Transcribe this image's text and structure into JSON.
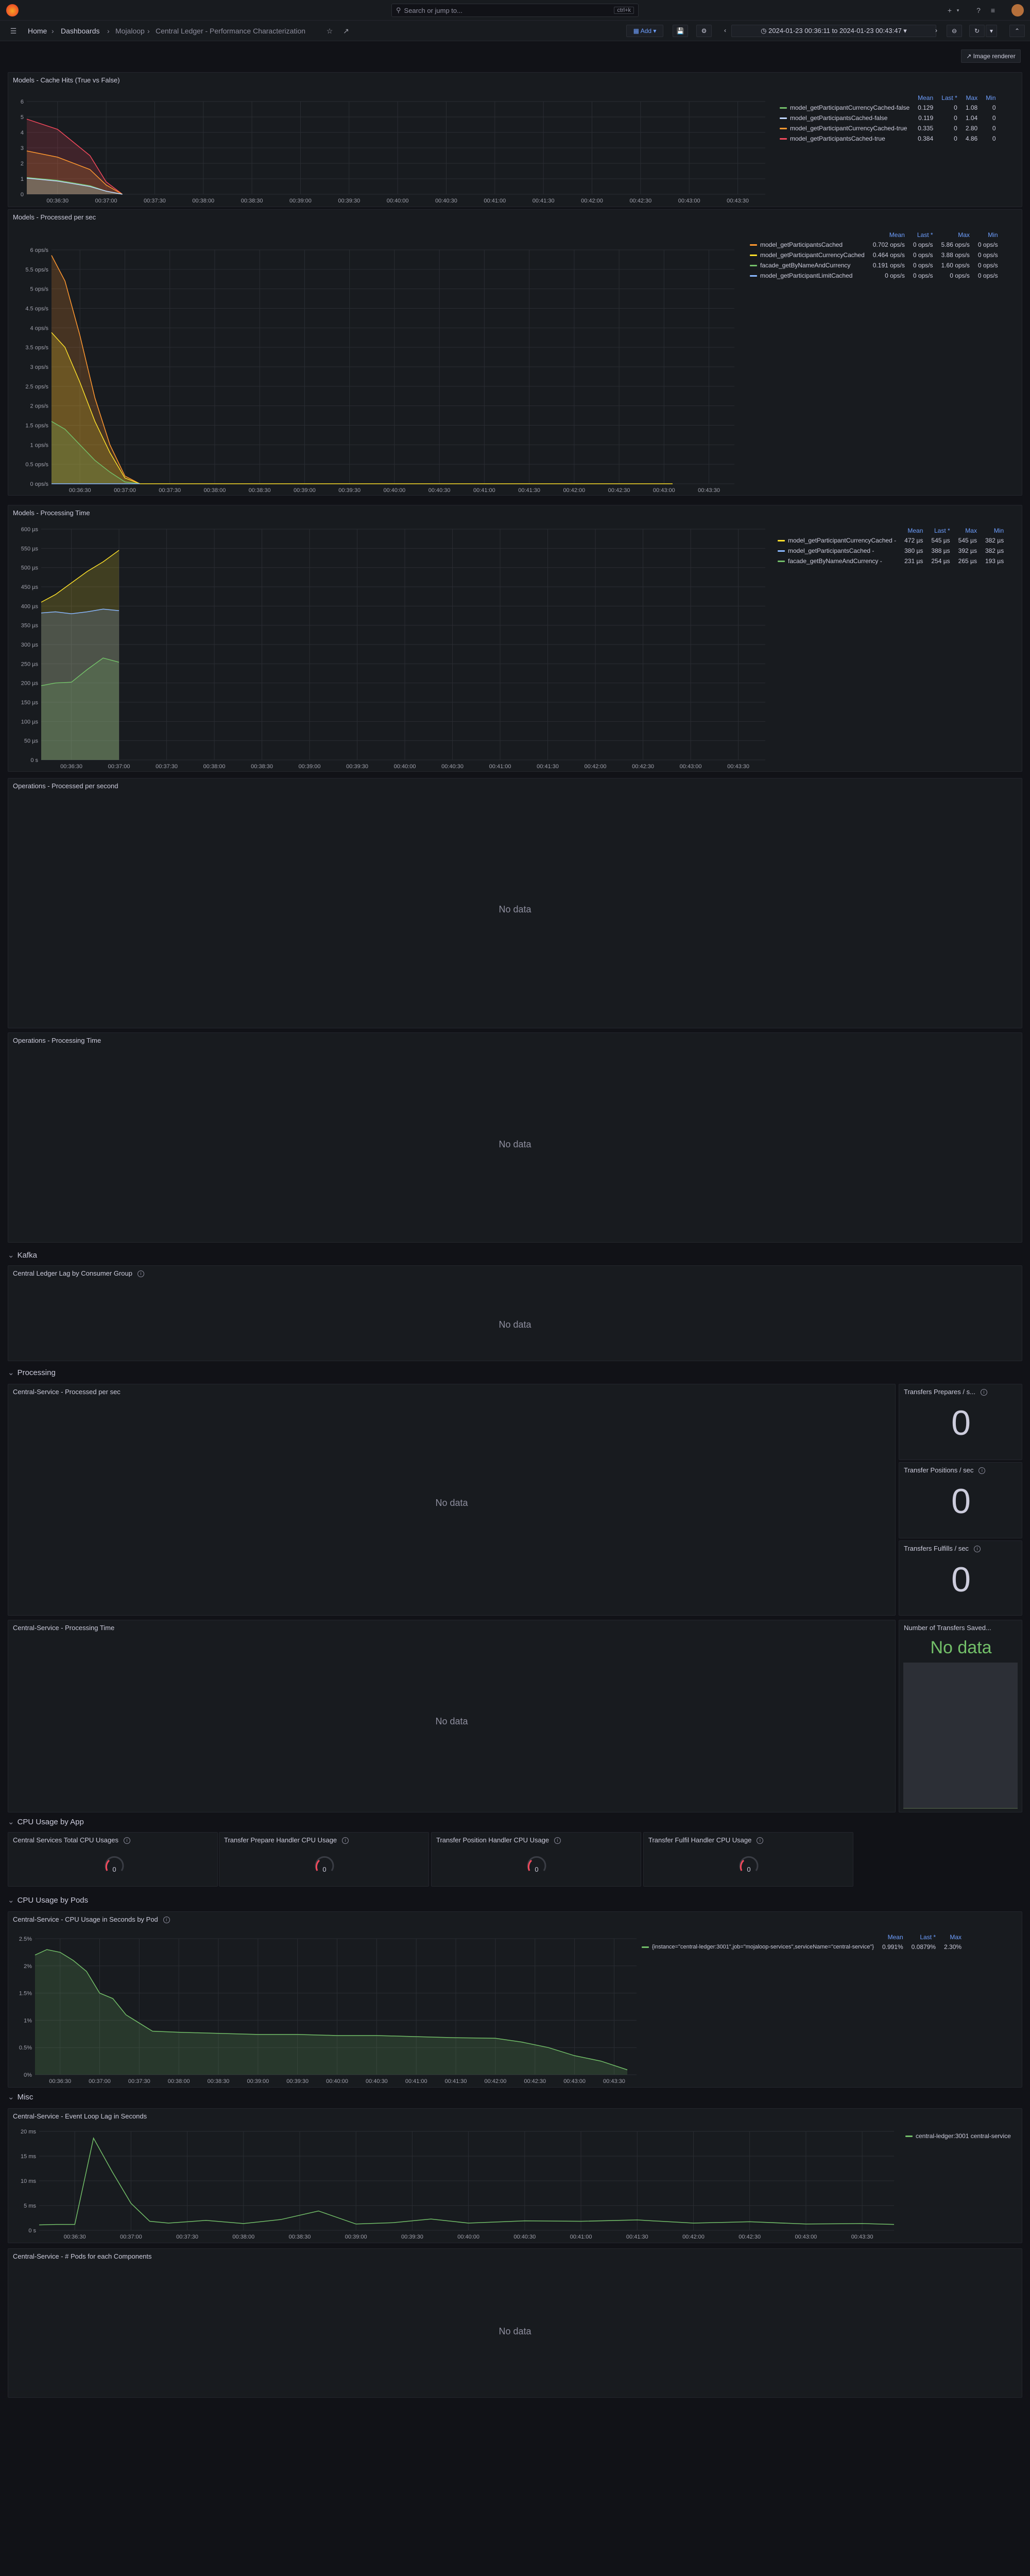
{
  "topbar": {
    "search_placeholder": "Search or jump to...",
    "search_shortcut": "ctrl+k"
  },
  "nav": {
    "home": "Home",
    "dashboards": "Dashboards",
    "folder": "Mojaloop",
    "dashboard": "Central Ledger - Performance Characterization",
    "add": "Add",
    "time_range": "2024-01-23 00:36:11 to 2024-01-23 00:43:47"
  },
  "image_renderer": "Image renderer",
  "tick_times_a": [
    "00:36:30",
    "00:37:00",
    "00:37:30",
    "00:38:00",
    "00:38:30",
    "00:39:00",
    "00:39:30",
    "00:40:00",
    "00:40:30",
    "00:41:00",
    "00:41:30",
    "00:42:00",
    "00:42:30",
    "00:43:00",
    "00:43:30"
  ],
  "panels": {
    "cache_hits": {
      "title": "Models - Cache Hits (True vs False)",
      "headers": [
        "Mean",
        "Last *",
        "Max",
        "Min"
      ],
      "rows": [
        {
          "name": "model_getParticipantCurrencyCached-false",
          "mean": "0.129",
          "last": "0",
          "max": "1.08",
          "min": "0",
          "color": "#73bf69"
        },
        {
          "name": "model_getParticipantsCached-false",
          "mean": "0.119",
          "last": "0",
          "max": "1.04",
          "min": "0",
          "color": "#c0d8ff"
        },
        {
          "name": "model_getParticipantCurrencyCached-true",
          "mean": "0.335",
          "last": "0",
          "max": "2.80",
          "min": "0",
          "color": "#ff9830"
        },
        {
          "name": "model_getParticipantsCached-true",
          "mean": "0.384",
          "last": "0",
          "max": "4.86",
          "min": "0",
          "color": "#f2495c"
        }
      ]
    },
    "processed": {
      "title": "Models - Processed per sec",
      "headers": [
        "Mean",
        "Last *",
        "Max",
        "Min"
      ],
      "rows": [
        {
          "name": "model_getParticipantsCached",
          "mean": "0.702 ops/s",
          "last": "0 ops/s",
          "max": "5.86 ops/s",
          "min": "0 ops/s",
          "color": "#ff9830"
        },
        {
          "name": "model_getParticipantCurrencyCached",
          "mean": "0.464 ops/s",
          "last": "0 ops/s",
          "max": "3.88 ops/s",
          "min": "0 ops/s",
          "color": "#fade2a"
        },
        {
          "name": "facade_getByNameAndCurrency",
          "mean": "0.191 ops/s",
          "last": "0 ops/s",
          "max": "1.60 ops/s",
          "min": "0 ops/s",
          "color": "#73bf69"
        },
        {
          "name": "model_getParticipantLimitCached",
          "mean": "0 ops/s",
          "last": "0 ops/s",
          "max": "0 ops/s",
          "min": "0 ops/s",
          "color": "#8ab8ff"
        }
      ]
    },
    "proc_time": {
      "title": "Models - Processing Time",
      "headers": [
        "Mean",
        "Last *",
        "Max",
        "Min"
      ],
      "rows": [
        {
          "name": "model_getParticipantCurrencyCached -",
          "mean": "472 µs",
          "last": "545 µs",
          "max": "545 µs",
          "min": "382 µs",
          "color": "#fade2a"
        },
        {
          "name": "model_getParticipantsCached -",
          "mean": "380 µs",
          "last": "388 µs",
          "max": "392 µs",
          "min": "382 µs",
          "color": "#8ab8ff"
        },
        {
          "name": "facade_getByNameAndCurrency -",
          "mean": "231 µs",
          "last": "254 µs",
          "max": "265 µs",
          "min": "193 µs",
          "color": "#73bf69"
        }
      ]
    },
    "ops_processed": {
      "title": "Operations - Processed per second",
      "nodata": "No data"
    },
    "ops_time": {
      "title": "Operations - Processing Time",
      "nodata": "No data"
    },
    "kafka_lag": {
      "title": "Central Ledger Lag by Consumer Group",
      "nodata": "No data"
    },
    "cs_processed": {
      "title": "Central-Service - Processed per sec",
      "nodata": "No data"
    },
    "tp_prepares": {
      "title": "Transfers Prepares / s...",
      "value": "0"
    },
    "tp_positions": {
      "title": "Transfer Positions / sec",
      "value": "0"
    },
    "tp_fulfils": {
      "title": "Transfers Fulfills / sec",
      "value": "0"
    },
    "cs_proc_time": {
      "title": "Central-Service - Processing Time",
      "nodata": "No data"
    },
    "saved": {
      "title": "Number of Transfers Saved...",
      "nodata": "No data"
    },
    "cpu_total": {
      "title": "Central Services Total CPU Usages",
      "value": "0"
    },
    "cpu_prepare": {
      "title": "Transfer Prepare Handler CPU Usage",
      "value": "0"
    },
    "cpu_position": {
      "title": "Transfer Position Handler CPU Usage",
      "value": "0"
    },
    "cpu_fulfil": {
      "title": "Transfer Fulfil Handler CPU Usage",
      "value": "0"
    },
    "cpu_pods": {
      "title": "Central-Service - CPU Usage in Seconds by Pod",
      "headers": [
        "Mean",
        "Last *",
        "Max"
      ],
      "rows": [
        {
          "name": "{instance=\"central-ledger:3001\",job=\"mojaloop-services\",serviceName=\"central-service\"}",
          "mean": "0.991%",
          "last": "0.0879%",
          "max": "2.30%",
          "color": "#73bf69"
        }
      ]
    },
    "event_loop": {
      "title": "Central-Service - Event Loop Lag in Seconds",
      "legend": "central-ledger:3001 central-service"
    },
    "pods": {
      "title": "Central-Service - # Pods for each Components",
      "nodata": "No data"
    }
  },
  "rows": {
    "kafka": "Kafka",
    "processing": "Processing",
    "cpu_app": "CPU Usage by App",
    "cpu_pods": "CPU Usage by Pods",
    "misc": "Misc"
  },
  "chart_data": [
    {
      "type": "area",
      "title": "Models - Cache Hits (True vs False)",
      "x": [
        "00:36:11",
        "00:36:30",
        "00:36:50",
        "00:37:00",
        "00:37:10"
      ],
      "ylim": [
        0,
        6
      ],
      "yticks": [
        "0",
        "1",
        "2",
        "3",
        "4",
        "5",
        "6"
      ],
      "series": [
        {
          "name": "model_getParticipantsCached-true",
          "values": [
            4.86,
            4.2,
            2.5,
            0.8,
            0
          ]
        },
        {
          "name": "model_getParticipantCurrencyCached-true",
          "values": [
            2.8,
            2.4,
            1.6,
            0.6,
            0
          ]
        },
        {
          "name": "model_getParticipantCurrencyCached-false",
          "values": [
            1.08,
            0.9,
            0.55,
            0.2,
            0
          ]
        },
        {
          "name": "model_getParticipantsCached-false",
          "values": [
            1.04,
            0.85,
            0.5,
            0.2,
            0
          ]
        }
      ]
    },
    {
      "type": "area",
      "title": "Models - Processed per sec",
      "x": [
        "00:36:11",
        "00:36:20",
        "00:36:30",
        "00:36:40",
        "00:36:50",
        "00:37:00",
        "00:37:10"
      ],
      "ylim": [
        0,
        6
      ],
      "yticks": [
        "0 ops/s",
        "0.5 ops/s",
        "1 ops/s",
        "1.5 ops/s",
        "2 ops/s",
        "2.5 ops/s",
        "3 ops/s",
        "3.5 ops/s",
        "4 ops/s",
        "4.5 ops/s",
        "5 ops/s",
        "5.5 ops/s",
        "6 ops/s"
      ],
      "series": [
        {
          "name": "model_getParticipantsCached",
          "values": [
            5.86,
            5.2,
            3.8,
            2.2,
            1.0,
            0.2,
            0
          ]
        },
        {
          "name": "model_getParticipantCurrencyCached",
          "values": [
            3.88,
            3.5,
            2.6,
            1.6,
            0.8,
            0.15,
            0
          ]
        },
        {
          "name": "facade_getByNameAndCurrency",
          "values": [
            1.6,
            1.4,
            1.0,
            0.6,
            0.3,
            0.05,
            0
          ]
        },
        {
          "name": "model_getParticipantLimitCached",
          "values": [
            0,
            0,
            0,
            0,
            0,
            0,
            0
          ]
        }
      ]
    },
    {
      "type": "area",
      "title": "Models - Processing Time",
      "x": [
        "00:36:11",
        "00:36:20",
        "00:36:30",
        "00:36:40",
        "00:36:50",
        "00:37:00"
      ],
      "ylim": [
        0,
        600
      ],
      "yticks": [
        "0 s",
        "50 µs",
        "100 µs",
        "150 µs",
        "200 µs",
        "250 µs",
        "300 µs",
        "350 µs",
        "400 µs",
        "450 µs",
        "500 µs",
        "550 µs",
        "600 µs"
      ],
      "series": [
        {
          "name": "model_getParticipantCurrencyCached -",
          "values": [
            410,
            430,
            460,
            490,
            515,
            545
          ]
        },
        {
          "name": "model_getParticipantsCached -",
          "values": [
            382,
            385,
            380,
            385,
            392,
            388
          ]
        },
        {
          "name": "facade_getByNameAndCurrency -",
          "values": [
            193,
            200,
            202,
            235,
            265,
            254
          ]
        }
      ]
    },
    {
      "type": "area",
      "title": "Central-Service - CPU Usage in Seconds by Pod",
      "x": [
        "00:36:11",
        "00:36:20",
        "00:36:30",
        "00:36:40",
        "00:36:50",
        "00:37:00",
        "00:37:10",
        "00:37:20",
        "00:37:30",
        "00:37:40",
        "00:38:00",
        "00:38:30",
        "00:39:00",
        "00:39:30",
        "00:40:00",
        "00:40:30",
        "00:41:00",
        "00:41:30",
        "00:42:00",
        "00:42:20",
        "00:42:40",
        "00:43:00",
        "00:43:20",
        "00:43:40"
      ],
      "ylim": [
        0,
        2.5
      ],
      "yticks": [
        "0%",
        "0.5%",
        "1%",
        "1.5%",
        "2%",
        "2.5%"
      ],
      "series": [
        {
          "name": "{instance=\"central-ledger:3001\",job=\"mojaloop-services\",serviceName=\"central-service\"}",
          "values": [
            2.2,
            2.3,
            2.25,
            2.1,
            1.9,
            1.5,
            1.4,
            1.1,
            0.95,
            0.8,
            0.78,
            0.76,
            0.74,
            0.74,
            0.72,
            0.72,
            0.7,
            0.68,
            0.67,
            0.6,
            0.5,
            0.35,
            0.25,
            0.09
          ]
        }
      ]
    },
    {
      "type": "line",
      "title": "Central-Service - Event Loop Lag in Seconds",
      "x": [
        "00:36:11",
        "00:36:20",
        "00:36:30",
        "00:36:40",
        "00:36:50",
        "00:37:00",
        "00:37:10",
        "00:37:20",
        "00:37:40",
        "00:38:00",
        "00:38:20",
        "00:38:40",
        "00:39:00",
        "00:39:20",
        "00:39:40",
        "00:40:00",
        "00:40:30",
        "00:41:00",
        "00:41:30",
        "00:42:00",
        "00:42:30",
        "00:43:00",
        "00:43:30",
        "00:43:47"
      ],
      "ylim": [
        0,
        22
      ],
      "yticks": [
        "0 s",
        "5 ms",
        "10 ms",
        "15 ms",
        "20 ms"
      ],
      "series": [
        {
          "name": "central-ledger:3001 central-service",
          "values": [
            1.2,
            1.3,
            1.3,
            20.5,
            13,
            6,
            2,
            1.6,
            2.2,
            1.5,
            2.4,
            4.3,
            1.4,
            1.7,
            2.5,
            1.6,
            2.1,
            2.0,
            2.3,
            1.6,
            1.9,
            1.4,
            1.5,
            1.3
          ]
        }
      ]
    }
  ]
}
